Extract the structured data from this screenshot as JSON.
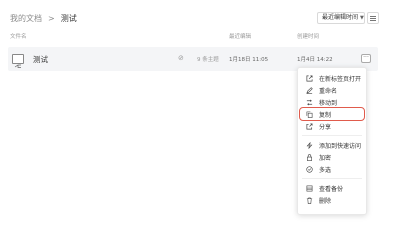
{
  "breadcrumb": {
    "parent": "我的文档",
    "separator": ">",
    "current": "测试"
  },
  "sort": {
    "label": "最近编辑时间"
  },
  "columns": {
    "name": "文件名",
    "last_edited": "最近编辑",
    "created": "创建时间"
  },
  "file": {
    "name": "测试",
    "topics": "9 条主题",
    "last_edited": "1月18日 11:05",
    "created": "1月4日 14:22"
  },
  "context_menu": {
    "items": [
      {
        "label": "在新标签页打开",
        "icon": "external-link-icon"
      },
      {
        "label": "重命名",
        "icon": "edit-icon"
      },
      {
        "label": "移动到",
        "icon": "move-icon"
      },
      {
        "label": "复制",
        "icon": "copy-icon",
        "highlighted": true
      },
      {
        "label": "分享",
        "icon": "share-icon"
      },
      {
        "label": "添加到快速访问",
        "icon": "lightning-icon"
      },
      {
        "label": "加密",
        "icon": "lock-icon"
      },
      {
        "label": "多选",
        "icon": "check-circle-icon"
      },
      {
        "label": "查看备份",
        "icon": "backup-icon"
      },
      {
        "label": "删除",
        "icon": "trash-icon"
      }
    ]
  },
  "colors": {
    "highlight_outline": "#e05b4c",
    "row_bg": "#f4f5f7"
  }
}
